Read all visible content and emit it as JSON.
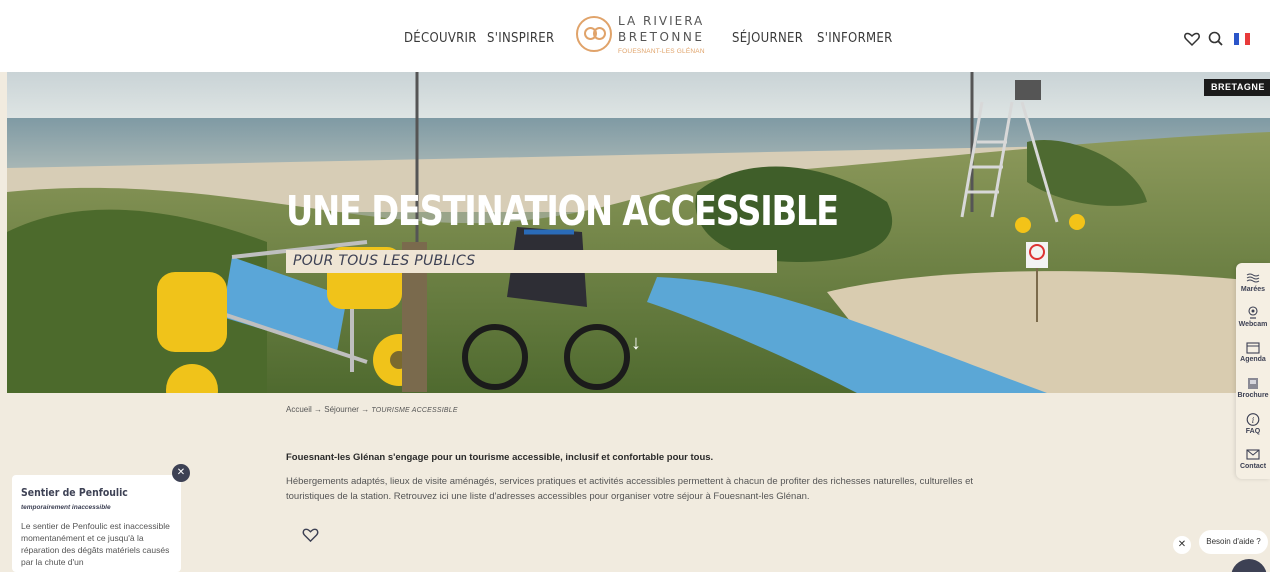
{
  "nav": {
    "left": [
      "DÉCOUVRIR",
      "S'INSPIRER"
    ],
    "right": [
      "SÉJOURNER",
      "S'INFORMER"
    ]
  },
  "logo": {
    "line1": "LA RIVIERA",
    "line2": "BRETONNE",
    "line3": "FOUESNANT-LES GLÉNAN"
  },
  "header_icons": [
    "heart-icon",
    "search-icon",
    "french-flag-icon"
  ],
  "hero": {
    "title": "UNE DESTINATION ACCESSIBLE",
    "subtitle": "POUR TOUS LES PUBLICS",
    "badge": "BRETAGNE"
  },
  "side_widget": [
    {
      "label": "Marées",
      "icon": "tide-icon"
    },
    {
      "label": "Webcam",
      "icon": "webcam-icon"
    },
    {
      "label": "Agenda",
      "icon": "calendar-icon"
    },
    {
      "label": "Brochure",
      "icon": "brochure-icon"
    },
    {
      "label": "FAQ",
      "icon": "info-icon"
    },
    {
      "label": "Contact",
      "icon": "mail-icon"
    }
  ],
  "breadcrumb": {
    "home": "Accueil",
    "sep": "→",
    "parent": "Séjourner",
    "current": "Tourisme accessible"
  },
  "content": {
    "intro_bold": "Fouesnant-les Glénan s'engage pour un tourisme accessible, inclusif et confortable pour tous.",
    "intro_text": "Hébergements adaptés, lieux de visite aménagés, services pratiques et activités accessibles permettent à chacun de profiter des richesses naturelles, culturelles et touristiques de la station. Retrouvez ici une liste d'adresses accessibles pour organiser votre séjour à Fouesnant-les Glénan."
  },
  "popup": {
    "title": "Sentier de Penfoulic",
    "subtitle": "temporairement inaccessible",
    "body": "Le sentier de Penfoulic est inaccessible momentanément et ce jusqu'à la réparation des dégâts matériels causés par la chute d'un",
    "close": "✕"
  },
  "help": {
    "label": "Besoin d'aide ?",
    "close": "✕"
  },
  "colors": {
    "background": "#f1ebdf",
    "navy": "#3d4154",
    "accent": "#e0a36a",
    "sand": "#efe5d4"
  }
}
